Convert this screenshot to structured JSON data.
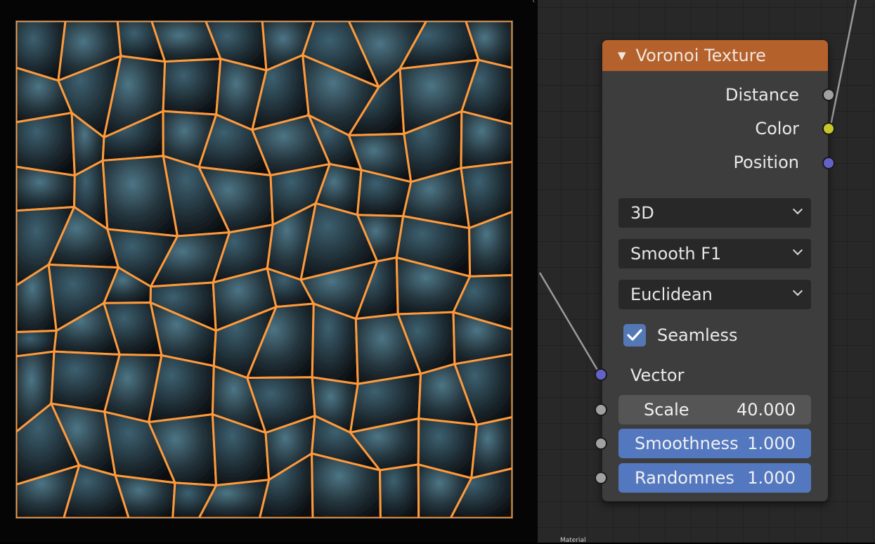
{
  "node": {
    "title": "Voronoi Texture",
    "outputs": [
      {
        "label": "Distance",
        "color": "#a1a1a1"
      },
      {
        "label": "Color",
        "color": "#c7c729"
      },
      {
        "label": "Position",
        "color": "#6363c7"
      }
    ],
    "dropdowns": [
      {
        "value": "3D"
      },
      {
        "value": "Smooth F1"
      },
      {
        "value": "Euclidean"
      }
    ],
    "seamless": {
      "label": "Seamless",
      "checked": true
    },
    "vector_input": {
      "label": "Vector",
      "color": "#6363c7"
    },
    "fields": [
      {
        "label": "Scale",
        "value": "40.000",
        "style": "grey"
      },
      {
        "label": "Smoothness",
        "value": "1.000",
        "style": "blue"
      },
      {
        "label": "Randomnes",
        "value": "1.000",
        "style": "blue"
      }
    ],
    "header_color": "#b4612c",
    "accent_color": "#5478c0"
  },
  "editor": {
    "footer_label": "Material"
  },
  "preview": {
    "description_icon": "lava-voronoi-render"
  }
}
